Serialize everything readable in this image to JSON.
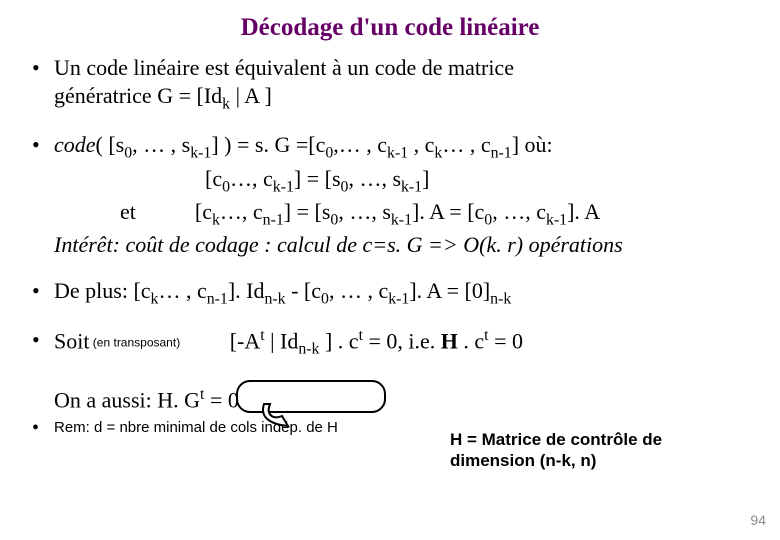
{
  "title": "Décodage d'un code linéaire",
  "bullet1": {
    "line1": "Un code linéaire est équivalent à un code de matrice",
    "line2_prefix": "génératrice G = [Id",
    "line2_sub": "k",
    "line2_suffix": " | A ]"
  },
  "bullet2": {
    "prefix_it": "code",
    "part1": "( [s",
    "s0": "0",
    "part2": ", … , s",
    "sk1": "k-1",
    "part3": "] ) = s. G =[c",
    "c0": "0",
    "part4": ",… , c",
    "ck1a": "k-1",
    "part5": " , c",
    "cka": "k",
    "part6": "… , c",
    "cn1": "n-1",
    "part7": "] où:"
  },
  "line_c_first": {
    "a": "[c",
    "s0": "0",
    "b": "…, c",
    "s1": "k-1",
    "c": "] = [s",
    "s2": "0",
    "d": ", …, s",
    "s3": "k-1",
    "e": "]"
  },
  "line_c_second": {
    "pre": "et",
    "a": "[c",
    "s0": "k",
    "b": "…, c",
    "s1": "n-1",
    "c": "] = [s",
    "s2": "0",
    "d": ", …, s",
    "s3": "k-1",
    "e": "]. A = [c",
    "s4": "0",
    "f": ", …, c",
    "s5": "k-1",
    "g": "]. A"
  },
  "interet": "Intérêt: coût de codage : calcul de c=s. G => O(k. r) opérations",
  "bullet3": {
    "a": "De plus: [c",
    "s0": "k",
    "b": "… , c",
    "s1": "n-1",
    "c": "]. Id",
    "s2": "n-k",
    "d": " - [c",
    "s3": "0",
    "e": ", … , c",
    "s4": "k-1",
    "f": "]. A  = [0]",
    "s5": "n-k"
  },
  "bullet4": {
    "a": "Soit",
    "small": " (en transposant)",
    "b": "         [-A",
    "sup1": "t",
    "c": " | Id",
    "s1": "n-k",
    "d": " ] . c",
    "sup2": "t",
    "e": "  = 0,   i.e.  ",
    "H": "H",
    "f": " . c",
    "sup3": "t",
    "g": " = 0"
  },
  "onaussi": {
    "a": "On a aussi: H. G",
    "sup": "t",
    "b": "  = 0"
  },
  "rem": "Rem: d = nbre minimal de cols indép. de H",
  "callout": {
    "l1": "H = Matrice de contrôle de",
    "l2": "dimension (n-k, n)"
  },
  "page": "94"
}
